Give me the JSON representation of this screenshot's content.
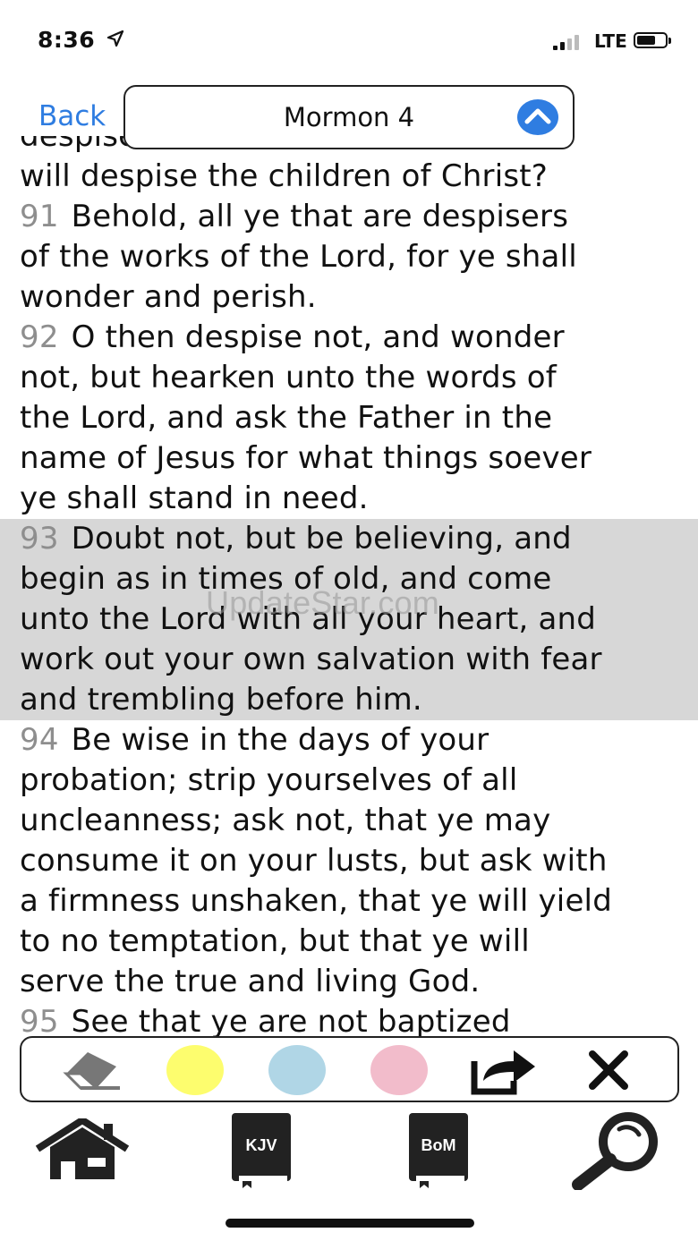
{
  "status_bar": {
    "time": "8:36",
    "network": "LTE"
  },
  "nav": {
    "back_label": "Back",
    "title": "Mormon 4"
  },
  "reader": {
    "top_partial_line": "despise the works of the Lord? Who",
    "intro_line": "will despise the children of Christ?",
    "verses": [
      {
        "number": "91",
        "lines": [
          "Behold, all ye that are despisers",
          "of the works of the Lord, for ye shall",
          "wonder and perish."
        ],
        "highlighted": false
      },
      {
        "number": "92",
        "lines": [
          "O then despise not, and wonder",
          "not, but hearken unto the words of",
          "the Lord, and ask the Father in the",
          "name of Jesus for what things soever",
          "ye shall stand in need."
        ],
        "highlighted": false
      },
      {
        "number": "93",
        "lines": [
          "Doubt not, but be believing, and",
          "begin as in times of old, and come",
          "unto the Lord with all your heart, and",
          "work out your own salvation with fear",
          "and trembling before him."
        ],
        "highlighted": true,
        "highlight_color": "#d7d7d7"
      },
      {
        "number": "94",
        "lines": [
          "Be wise in the days of your",
          "probation; strip yourselves of all",
          "uncleanness; ask not, that ye may",
          "consume it on your lusts, but ask with",
          "a firmness unshaken, that ye will yield",
          "to no temptation, but that ye will",
          "serve the true and living God."
        ],
        "highlighted": false
      }
    ],
    "bottom_partial_number": "95",
    "bottom_partial_line": "See that ye are not baptized",
    "watermark": "UpdateStar.com"
  },
  "highlight_toolbar": {
    "colors": {
      "yellow": "#fdfd6e",
      "blue": "#b0d6e6",
      "pink": "#f2bccb"
    },
    "icons": [
      "eraser-icon",
      "highlight-yellow",
      "highlight-blue",
      "highlight-pink",
      "share-icon",
      "close-icon"
    ]
  },
  "tab_bar": {
    "home_icon": "home-icon",
    "kjv_label": "KJV",
    "bom_label": "BoM",
    "search_icon": "search-icon"
  },
  "colors": {
    "accent": "#2f7de1",
    "verse_number": "#8e8e8e",
    "highlight": "#d7d7d7"
  }
}
